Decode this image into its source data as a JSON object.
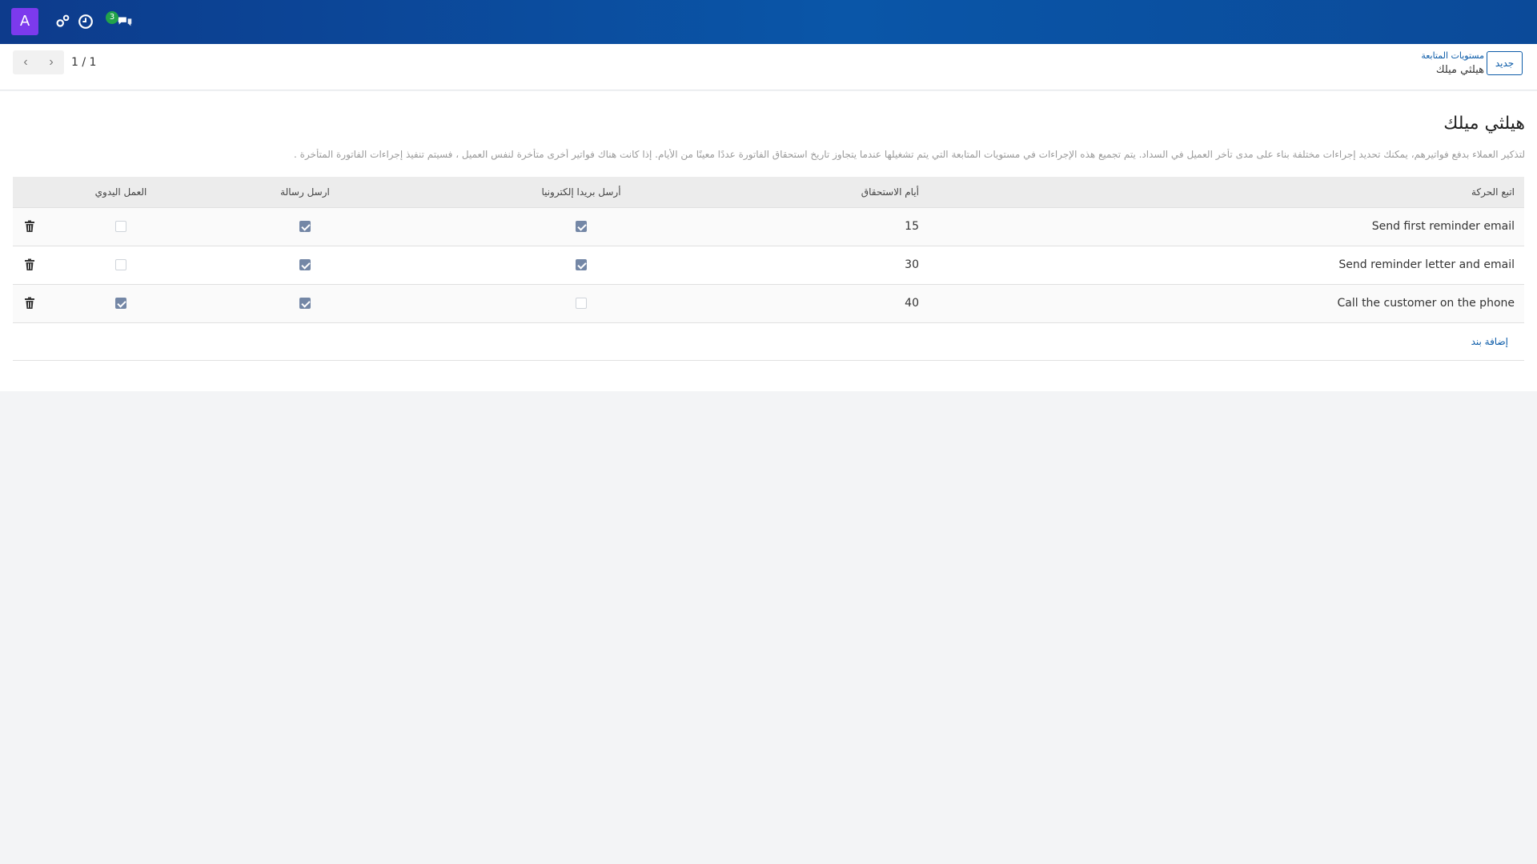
{
  "navbar": {
    "avatar_letter": "A",
    "chat_badge_count": "3",
    "icons": [
      "settings-icon",
      "clock-icon",
      "chat-icon"
    ],
    "colors": {
      "bar": "#0a56a8",
      "avatar": "#7c3aed",
      "badge": "#22a34a"
    }
  },
  "control_panel": {
    "create_label": "جديد",
    "breadcrumb_parent": "مستويات المتابعة",
    "breadcrumb_current": "هيلثي ميلك",
    "pager_value": "1 / 1"
  },
  "form": {
    "title": "هيلثي ميلك",
    "description": "لتذكير العملاء بدفع فواتيرهم، يمكنك تحديد إجراءات مختلفة بناء على مدى تأخر العميل في السداد. يتم تجميع هذه الإجراءات في مستويات المتابعة التي يتم تشغيلها عندما يتجاوز تاريخ استحقاق الفاتورة عددًا معينًا من الأيام. إذا كانت هناك فواتير أخرى متأخرة لنفس العميل ، فسيتم تنفيذ إجراءات الفاتورة المتأخرة ."
  },
  "table": {
    "headers": {
      "action": "اتبع الحركة",
      "due_days": "أيام الاستحقاق",
      "send_email": "أرسل بريدا إلكترونيا",
      "send_letter": "ارسل رسالة",
      "manual_action": "العمل اليدوي"
    },
    "rows": [
      {
        "action": "Send first reminder email",
        "due_days": "15",
        "send_email": true,
        "send_letter": true,
        "manual_action": false
      },
      {
        "action": "Send reminder letter and email",
        "due_days": "30",
        "send_email": true,
        "send_letter": true,
        "manual_action": false
      },
      {
        "action": "Call the customer on the phone",
        "due_days": "40",
        "send_email": false,
        "send_letter": true,
        "manual_action": true
      }
    ],
    "add_line_label": "إضافة بند"
  }
}
